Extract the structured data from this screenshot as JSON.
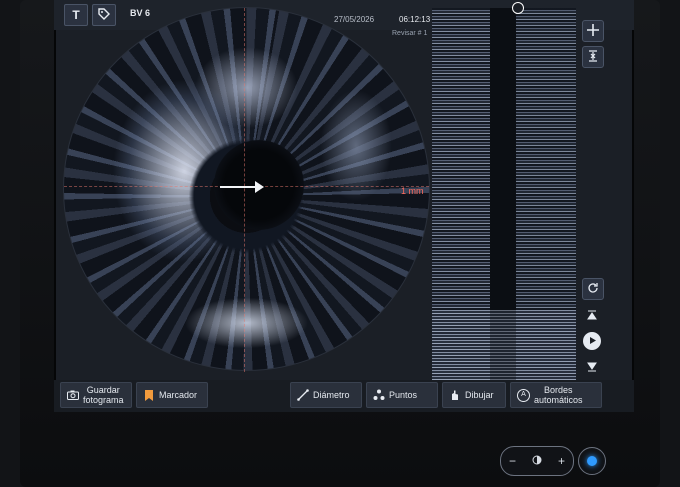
{
  "header": {
    "text_button": "T",
    "device": "BV 6",
    "date": "27/05/2026",
    "time": "06:12:13",
    "review": "Revisar # 1"
  },
  "image": {
    "scale": "1 mm"
  },
  "toolbar": {
    "save_photo": [
      "Guardar",
      "fotograma"
    ],
    "marker": "Marcador",
    "diameter": "Diámetro",
    "points": "Puntos",
    "draw": "Dibujar",
    "auto_borders": [
      "Bordes",
      "automáticos"
    ],
    "auto_borders_icon_letter": "A"
  },
  "hardware": {
    "minus": "−",
    "plus": "+"
  },
  "colors": {
    "accent_blue": "#2f9bff",
    "scale_red": "#ff6b5c",
    "marker_orange": "#f29b3d"
  },
  "icons": {
    "camera": "camera-icon",
    "bookmark": "bookmark-icon",
    "diameter": "ruler-diagonal-icon",
    "points": "points-icon",
    "draw": "draw-hand-icon",
    "crosshair": "crosshair-icon",
    "collapse": "collapse-icon",
    "refresh": "refresh-icon",
    "prev": "step-up-icon",
    "play": "play-icon",
    "next": "step-down-icon",
    "brightness": "brightness-icon",
    "power": "power-icon"
  }
}
